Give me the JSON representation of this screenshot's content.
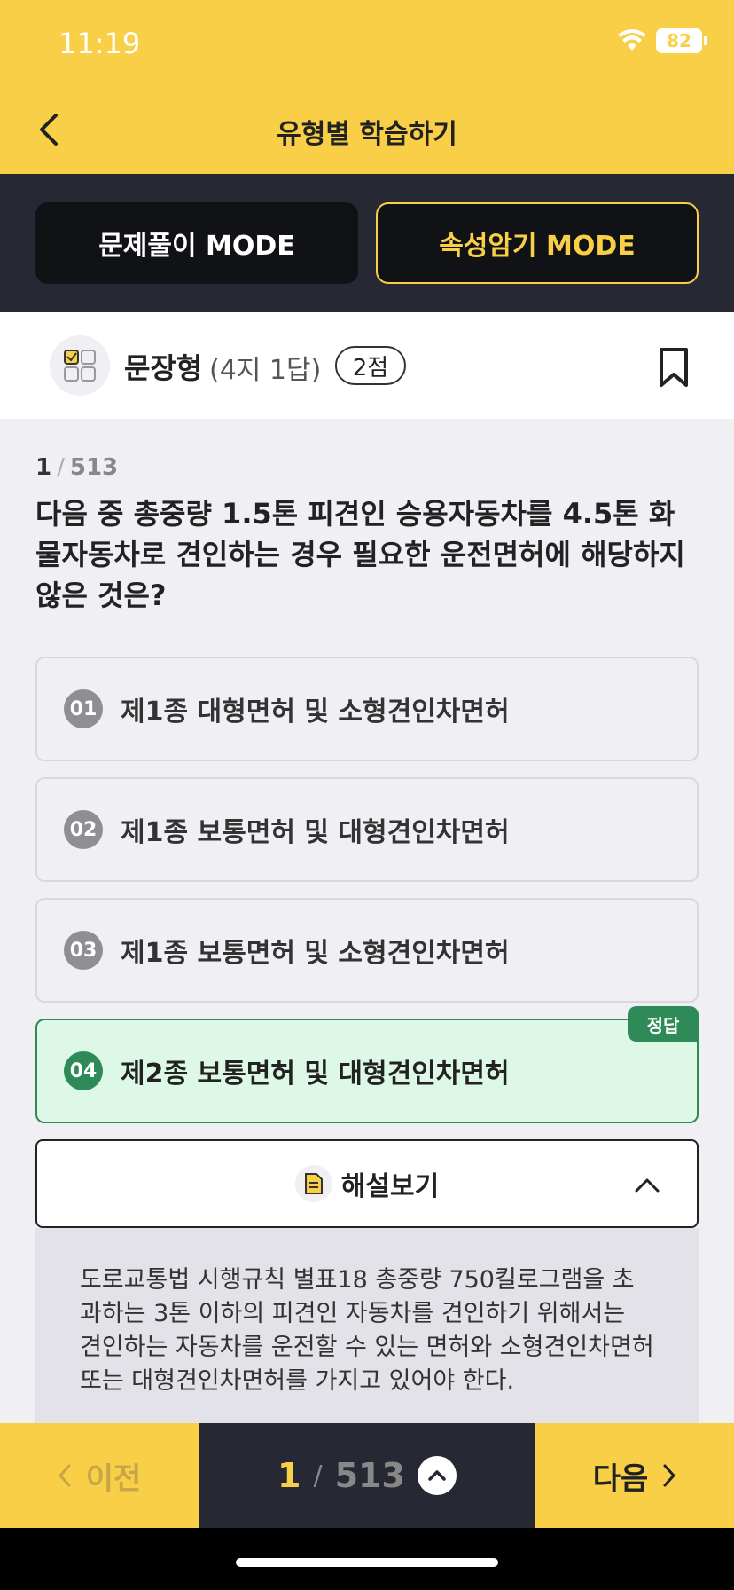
{
  "status": {
    "time": "11:19",
    "battery": "82"
  },
  "nav": {
    "title": "유형별 학습하기"
  },
  "modes": {
    "quiz": "문제풀이 MODE",
    "memorize": "속성암기 MODE"
  },
  "type": {
    "name": "문장형",
    "sub": "(4지 1답)",
    "score": "2점"
  },
  "question": {
    "current": "1",
    "total": "513",
    "text": "다음 중 총중량 1.5톤 피견인 승용자동차를 4.5톤 화물자동차로 견인하는 경우 필요한 운전면허에 해당하지 않은 것은?"
  },
  "options": [
    {
      "num": "01",
      "text": "제1종 대형면허 및 소형견인차면허"
    },
    {
      "num": "02",
      "text": "제1종 보통면허 및 대형견인차면허"
    },
    {
      "num": "03",
      "text": "제1종 보통면허 및 소형견인차면허"
    },
    {
      "num": "04",
      "text": "제2종 보통면허 및 대형견인차면허"
    }
  ],
  "answer_badge": "정답",
  "explanation": {
    "title": "해설보기",
    "text": "도로교통법 시행규칙 별표18 총중량 750킬로그램을 초과하는 3톤 이하의 피견인 자동차를 견인하기 위해서는 견인하는 자동차를 운전할 수 있는 면허와 소형견인차면허 또는 대형견인차면허를 가지고 있어야 한다."
  },
  "bottom": {
    "prev": "이전",
    "next": "다음",
    "current": "1",
    "total": "513"
  },
  "colors": {
    "accent": "#f8cf46",
    "dark": "#262833",
    "correct": "#2e8b57"
  }
}
